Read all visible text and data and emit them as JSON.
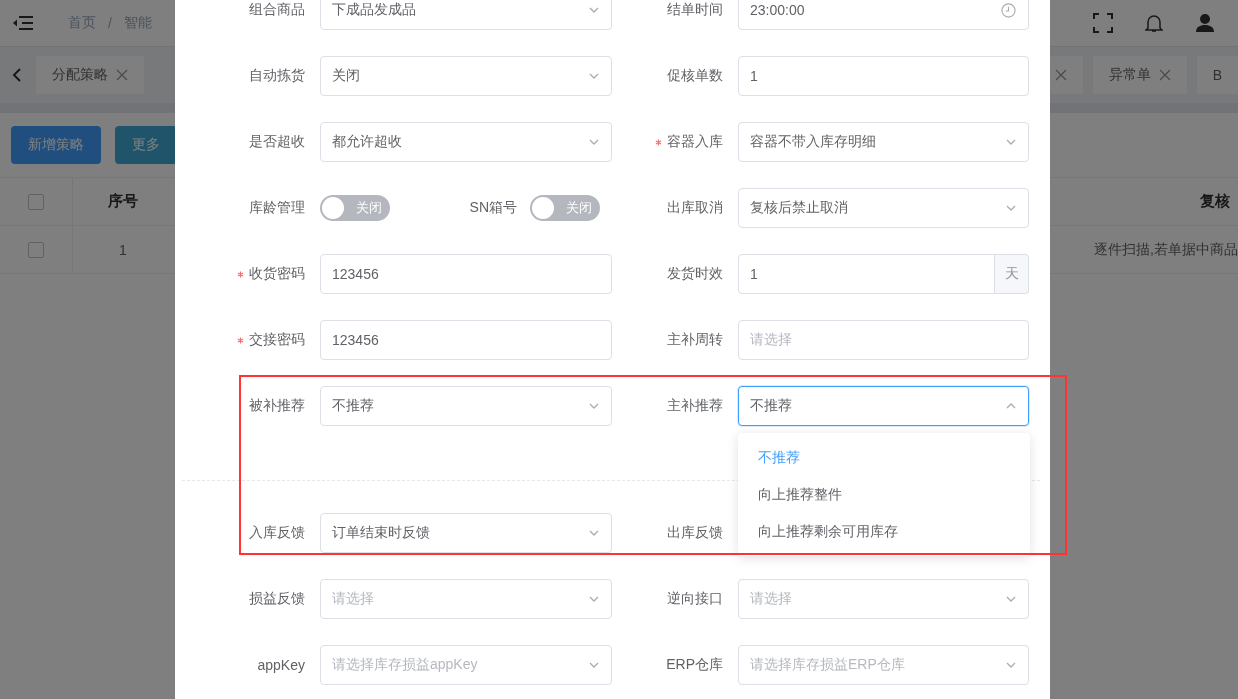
{
  "header": {
    "breadcrumb": [
      "首页",
      "/",
      "智能"
    ]
  },
  "tabs_left": [
    {
      "label": "分配策略",
      "closable": true
    }
  ],
  "tabs_right": [
    {
      "closable": true
    },
    {
      "label": "异常单",
      "closable": true
    },
    {
      "label": "B",
      "closable": false
    }
  ],
  "toolbar": {
    "buttons": [
      {
        "label": "新增策略",
        "kind": "primary"
      },
      {
        "label": "更多",
        "kind": "info"
      }
    ]
  },
  "table": {
    "header_checked": false,
    "columns": [
      "序号",
      "复核"
    ],
    "rows": [
      {
        "selected": false,
        "cells": [
          "1",
          "逐件扫描,若单据中商品"
        ]
      }
    ]
  },
  "dialog": {
    "sections": [
      {
        "rows": [
          {
            "left": {
              "kind": "select",
              "label": "组合商品",
              "value": "下成品发成品"
            },
            "right": {
              "kind": "time",
              "label": "结单时间",
              "value": "23:00:00"
            }
          },
          {
            "left": {
              "kind": "select",
              "label": "自动拣货",
              "value": "关闭"
            },
            "right": {
              "kind": "input",
              "label": "促核单数",
              "value": "1"
            }
          },
          {
            "left": {
              "kind": "select",
              "label": "是否超收",
              "value": "都允许超收"
            },
            "right": {
              "kind": "select",
              "label": "容器入库",
              "required": true,
              "value": "容器不带入库存明细"
            }
          },
          {
            "left": {
              "kind": "switches",
              "items": [
                {
                  "label": "库龄管理",
                  "on": false,
                  "text": "关闭"
                },
                {
                  "label": "SN箱号",
                  "on": false,
                  "text": "关闭"
                }
              ]
            },
            "right": {
              "kind": "select",
              "label": "出库取消",
              "value": "复核后禁止取消"
            }
          },
          {
            "left": {
              "kind": "input",
              "label": "收货密码",
              "required": true,
              "value": "123456"
            },
            "right": {
              "kind": "suffix",
              "label": "发货时效",
              "value": "1",
              "suffix": "天"
            }
          },
          {
            "left": {
              "kind": "input",
              "label": "交接密码",
              "required": true,
              "value": "123456"
            },
            "right": {
              "kind": "input",
              "label": "主补周转",
              "placeholder": "请选择"
            }
          },
          {
            "left": {
              "kind": "select",
              "label": "被补推荐",
              "value": "不推荐"
            },
            "right": {
              "kind": "select",
              "label": "主补推荐",
              "value": "不推荐",
              "open": true,
              "options": [
                {
                  "label": "不推荐",
                  "selected": true
                },
                {
                  "label": "向上推荐整件",
                  "selected": false
                },
                {
                  "label": "向上推荐剩余可用库存",
                  "selected": false
                }
              ]
            }
          }
        ]
      },
      {
        "rows": [
          {
            "left": {
              "kind": "select",
              "label": "入库反馈",
              "value": "订单结束时反馈"
            },
            "right": {
              "label": "出库反馈"
            }
          },
          {
            "left": {
              "kind": "select",
              "label": "损益反馈",
              "placeholder": "请选择"
            },
            "right": {
              "kind": "select",
              "label": "逆向接口",
              "placeholder": "请选择"
            }
          },
          {
            "left": {
              "kind": "select",
              "label": "appKey",
              "placeholder": "请选择库存损益appKey"
            },
            "right": {
              "kind": "select",
              "label": "ERP仓库",
              "placeholder": "请选择库存损益ERP仓库"
            }
          }
        ]
      }
    ]
  }
}
